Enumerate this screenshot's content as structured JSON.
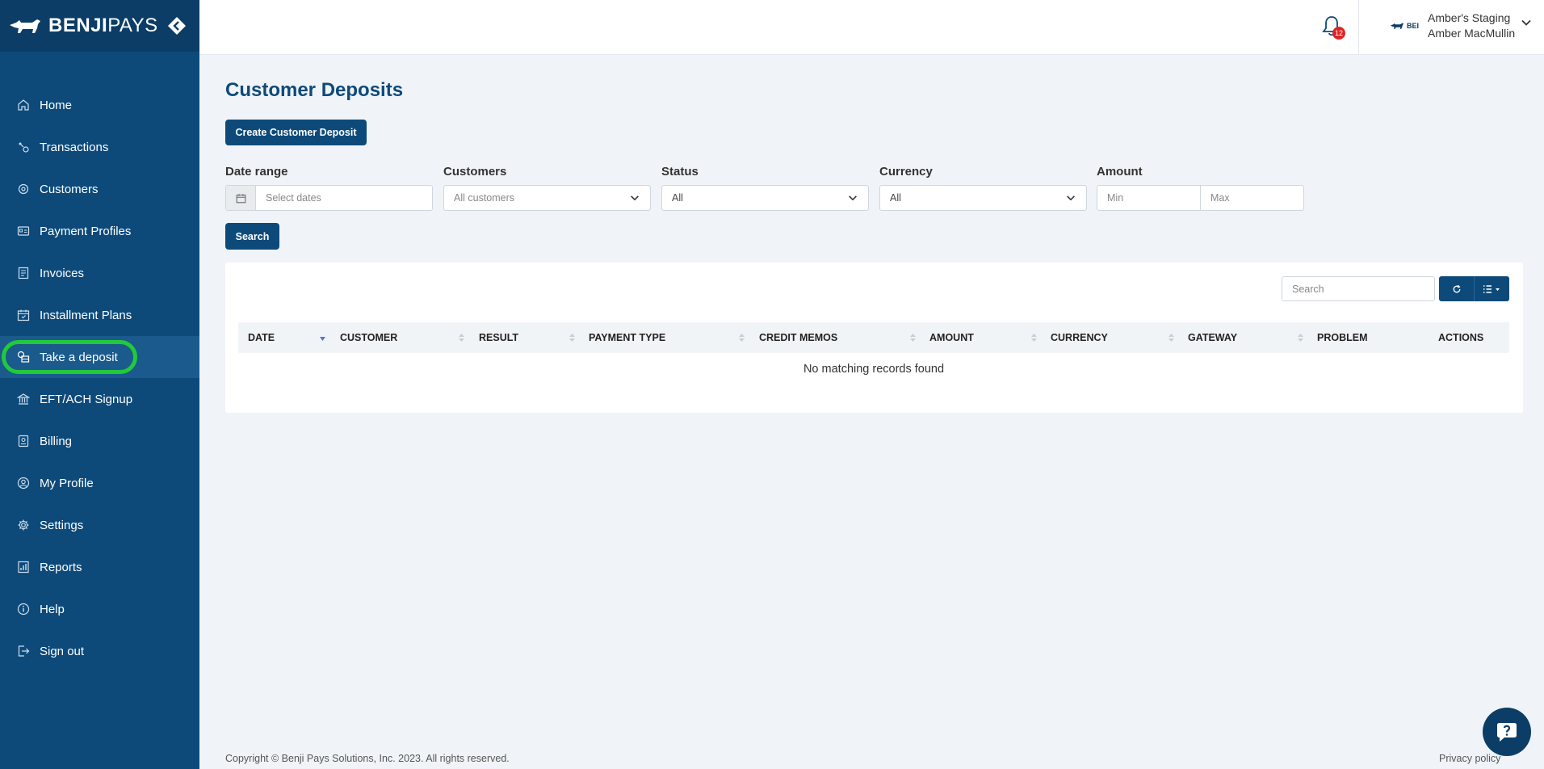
{
  "brand": {
    "name_bold": "BENJI",
    "name_light": "PAYS"
  },
  "sidebar": {
    "items": [
      {
        "label": "Home",
        "icon": "home-icon"
      },
      {
        "label": "Transactions",
        "icon": "transactions-icon"
      },
      {
        "label": "Customers",
        "icon": "customers-icon"
      },
      {
        "label": "Payment Profiles",
        "icon": "payment-profiles-icon"
      },
      {
        "label": "Invoices",
        "icon": "invoice-icon"
      },
      {
        "label": "Installment Plans",
        "icon": "calendar-icon"
      },
      {
        "label": "Take a deposit",
        "icon": "deposit-icon",
        "active": true
      },
      {
        "label": "EFT/ACH Signup",
        "icon": "bank-icon"
      },
      {
        "label": "Billing",
        "icon": "billing-icon"
      },
      {
        "label": "My Profile",
        "icon": "profile-icon"
      },
      {
        "label": "Settings",
        "icon": "gear-icon"
      },
      {
        "label": "Reports",
        "icon": "reports-icon"
      },
      {
        "label": "Help",
        "icon": "info-icon"
      },
      {
        "label": "Sign out",
        "icon": "sign-out-icon"
      }
    ]
  },
  "header": {
    "notification_count": "12",
    "org_name": "Amber's Staging",
    "user_name": "Amber MacMullin",
    "logo_text": "BEI"
  },
  "page": {
    "title": "Customer Deposits",
    "create_button": "Create Customer Deposit",
    "search_button": "Search"
  },
  "filters": {
    "date_label": "Date range",
    "date_placeholder": "Select dates",
    "customers_label": "Customers",
    "customers_value": "All customers",
    "status_label": "Status",
    "status_value": "All",
    "currency_label": "Currency",
    "currency_value": "All",
    "amount_label": "Amount",
    "amount_min_placeholder": "Min",
    "amount_max_placeholder": "Max"
  },
  "table": {
    "search_placeholder": "Search",
    "columns": [
      "DATE",
      "CUSTOMER",
      "RESULT",
      "PAYMENT TYPE",
      "CREDIT MEMOS",
      "AMOUNT",
      "CURRENCY",
      "GATEWAY",
      "PROBLEM",
      "ACTIONS"
    ],
    "empty_message": "No matching records found"
  },
  "footer": {
    "copyright": "Copyright © Benji Pays Solutions, Inc. 2023. All rights reserved.",
    "privacy": "Privacy policy"
  },
  "colors": {
    "sidebar": "#0d4a7a",
    "brand_bar": "#0b3d66",
    "primary": "#0d4a7a",
    "highlight": "#22c93a",
    "badge": "#e02424"
  }
}
